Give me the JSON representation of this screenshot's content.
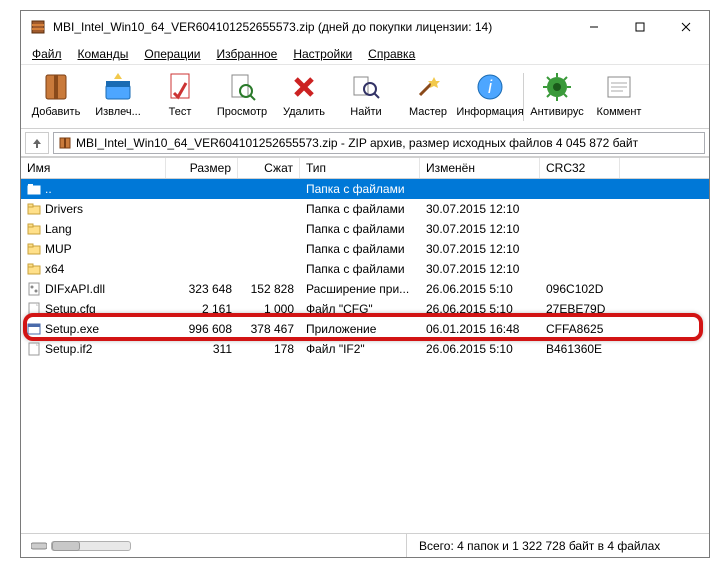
{
  "window": {
    "title": "MBI_Intel_Win10_64_VER604101252655573.zip (дней до покупки лицензии: 14)"
  },
  "menu": {
    "file": "Файл",
    "commands": "Команды",
    "operations": "Операции",
    "favorites": "Избранное",
    "settings": "Настройки",
    "help": "Справка"
  },
  "toolbar": {
    "add": "Добавить",
    "extract": "Извлеч...",
    "test": "Тест",
    "view": "Просмотр",
    "delete": "Удалить",
    "find": "Найти",
    "wizard": "Мастер",
    "info": "Информация",
    "antivirus": "Антивирус",
    "comment": "Коммент"
  },
  "pathbar": {
    "text": "MBI_Intel_Win10_64_VER604101252655573.zip - ZIP архив, размер исходных файлов 4 045 872 байт"
  },
  "columns": {
    "name": "Имя",
    "size": "Размер",
    "packed": "Сжат",
    "type": "Тип",
    "modified": "Изменён",
    "crc": "CRC32"
  },
  "rows": [
    {
      "icon": "updir",
      "name": "..",
      "size": "",
      "packed": "",
      "type": "Папка с файлами",
      "modified": "",
      "crc": "",
      "selected": true
    },
    {
      "icon": "folder",
      "name": "Drivers",
      "size": "",
      "packed": "",
      "type": "Папка с файлами",
      "modified": "30.07.2015 12:10",
      "crc": ""
    },
    {
      "icon": "folder",
      "name": "Lang",
      "size": "",
      "packed": "",
      "type": "Папка с файлами",
      "modified": "30.07.2015 12:10",
      "crc": ""
    },
    {
      "icon": "folder",
      "name": "MUP",
      "size": "",
      "packed": "",
      "type": "Папка с файлами",
      "modified": "30.07.2015 12:10",
      "crc": ""
    },
    {
      "icon": "folder",
      "name": "x64",
      "size": "",
      "packed": "",
      "type": "Папка с файлами",
      "modified": "30.07.2015 12:10",
      "crc": ""
    },
    {
      "icon": "dll",
      "name": "DIFxAPI.dll",
      "size": "323 648",
      "packed": "152 828",
      "type": "Расширение при...",
      "modified": "26.06.2015 5:10",
      "crc": "096C102D"
    },
    {
      "icon": "file",
      "name": "Setup.cfg",
      "size": "2 161",
      "packed": "1 000",
      "type": "Файл \"CFG\"",
      "modified": "26.06.2015 5:10",
      "crc": "27EBE79D"
    },
    {
      "icon": "exe",
      "name": "Setup.exe",
      "size": "996 608",
      "packed": "378 467",
      "type": "Приложение",
      "modified": "06.01.2015 16:48",
      "crc": "CFFA8625"
    },
    {
      "icon": "file",
      "name": "Setup.if2",
      "size": "311",
      "packed": "178",
      "type": "Файл \"IF2\"",
      "modified": "26.06.2015 5:10",
      "crc": "B461360E"
    }
  ],
  "status": {
    "right": "Всего: 4 папок и 1 322 728 байт в 4 файлах"
  }
}
